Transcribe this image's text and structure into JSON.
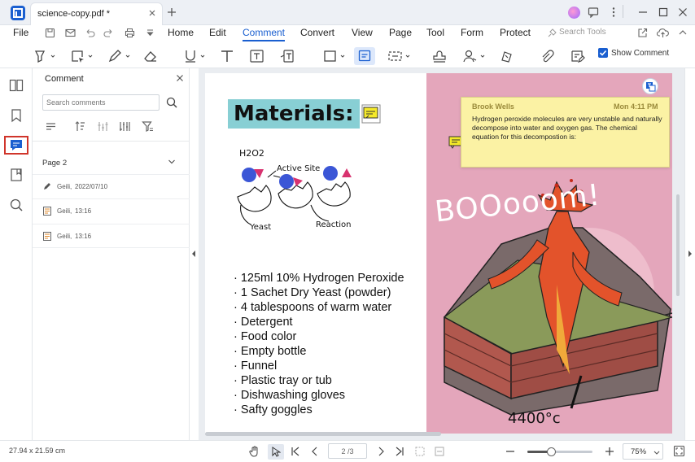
{
  "window": {
    "tab_title": "science-copy.pdf *"
  },
  "menu": {
    "file": "File",
    "items": [
      "Home",
      "Edit",
      "Comment",
      "Convert",
      "View",
      "Page",
      "Tool",
      "Form",
      "Protect"
    ],
    "active": "Comment",
    "search_tools": "Search Tools"
  },
  "toolbar": {
    "show_comment_label": "Show Comment",
    "show_comment_checked": true
  },
  "panel": {
    "title": "Comment",
    "search_placeholder": "Search comments",
    "page_label": "Page 2",
    "comments": [
      {
        "icon": "pen-icon",
        "author": "Geili,",
        "time": "2022/07/10"
      },
      {
        "icon": "note-icon",
        "author": "Geili,",
        "time": "13:16"
      },
      {
        "icon": "note-icon",
        "author": "Geili,",
        "time": "13:16"
      }
    ]
  },
  "document": {
    "left": {
      "title": "Materials:",
      "diagram_labels": {
        "h2o2": "H2O2",
        "active_site": "Active Site",
        "yeast": "Yeast",
        "reaction": "Reaction"
      },
      "materials": [
        "125ml 10% Hydrogen Peroxide",
        "1 Sachet Dry Yeast (powder)",
        "4 tablespoons of warm water",
        "Detergent",
        "Food color",
        "Empty bottle",
        "Funnel",
        "Plastic tray or tub",
        "Dishwashing gloves",
        "Safty goggles"
      ]
    },
    "right": {
      "boom": "BOOooom!",
      "temperature": "4400°c",
      "comment_popup": {
        "author": "Brook Wells",
        "time": "Mon 4:11 PM",
        "text": "Hydrogen peroxide molecules are very unstable and naturally decompose into water and oxygen gas. The chemical equation for this decompostion is:"
      }
    }
  },
  "status": {
    "dimensions": "27.94 x 21.59 cm",
    "page_current": "2",
    "page_total": "/3",
    "page_display": "2 /3",
    "zoom": "75%",
    "zoom_slider_fraction": 0.36
  },
  "colors": {
    "accent": "#1a5fd0",
    "title_highlight": "#88cfd4",
    "pink_page": "#e4a6bb",
    "sticky_note": "#fbf2a4",
    "selection_box": "#d0352b"
  }
}
